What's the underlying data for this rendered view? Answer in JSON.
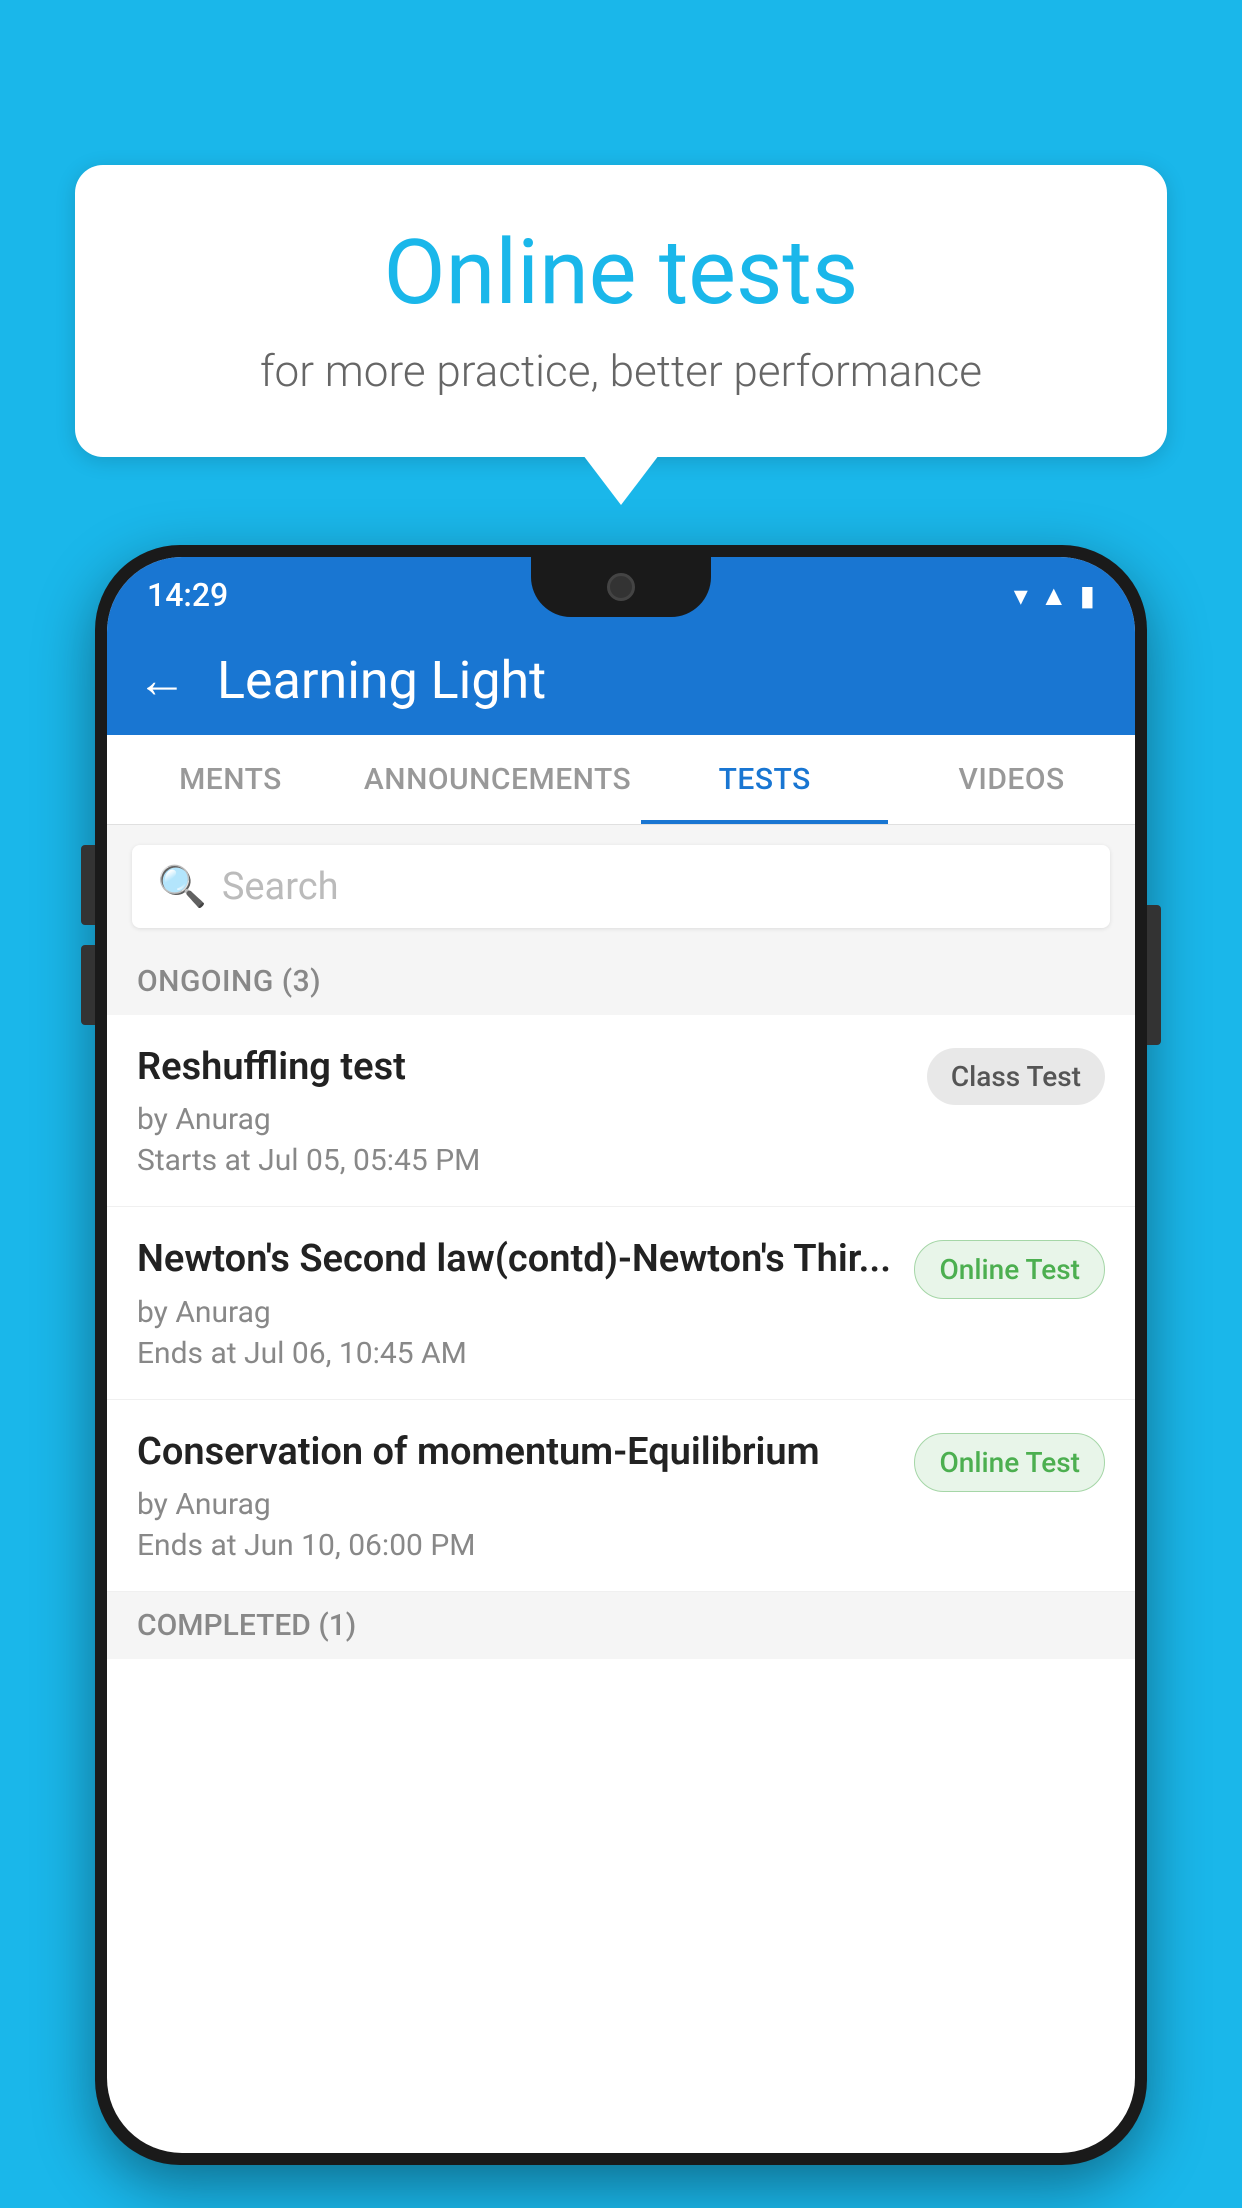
{
  "background_color": "#1ab7ea",
  "bubble": {
    "title": "Online tests",
    "subtitle": "for more practice, better performance"
  },
  "phone": {
    "status_bar": {
      "time": "14:29",
      "icons": [
        "wifi",
        "signal",
        "battery"
      ]
    },
    "app_bar": {
      "title": "Learning Light",
      "back_label": "←"
    },
    "tabs": [
      {
        "label": "MENTS",
        "active": false
      },
      {
        "label": "ANNOUNCEMENTS",
        "active": false
      },
      {
        "label": "TESTS",
        "active": true
      },
      {
        "label": "VIDEOS",
        "active": false
      }
    ],
    "search": {
      "placeholder": "Search"
    },
    "sections": [
      {
        "header": "ONGOING (3)",
        "items": [
          {
            "name": "Reshuffling test",
            "by": "by Anurag",
            "time": "Starts at  Jul 05, 05:45 PM",
            "badge": "Class Test",
            "badge_type": "class"
          },
          {
            "name": "Newton's Second law(contd)-Newton's Thir...",
            "by": "by Anurag",
            "time": "Ends at  Jul 06, 10:45 AM",
            "badge": "Online Test",
            "badge_type": "online"
          },
          {
            "name": "Conservation of momentum-Equilibrium",
            "by": "by Anurag",
            "time": "Ends at  Jun 10, 06:00 PM",
            "badge": "Online Test",
            "badge_type": "online"
          }
        ]
      },
      {
        "header": "COMPLETED (1)",
        "items": []
      }
    ]
  }
}
